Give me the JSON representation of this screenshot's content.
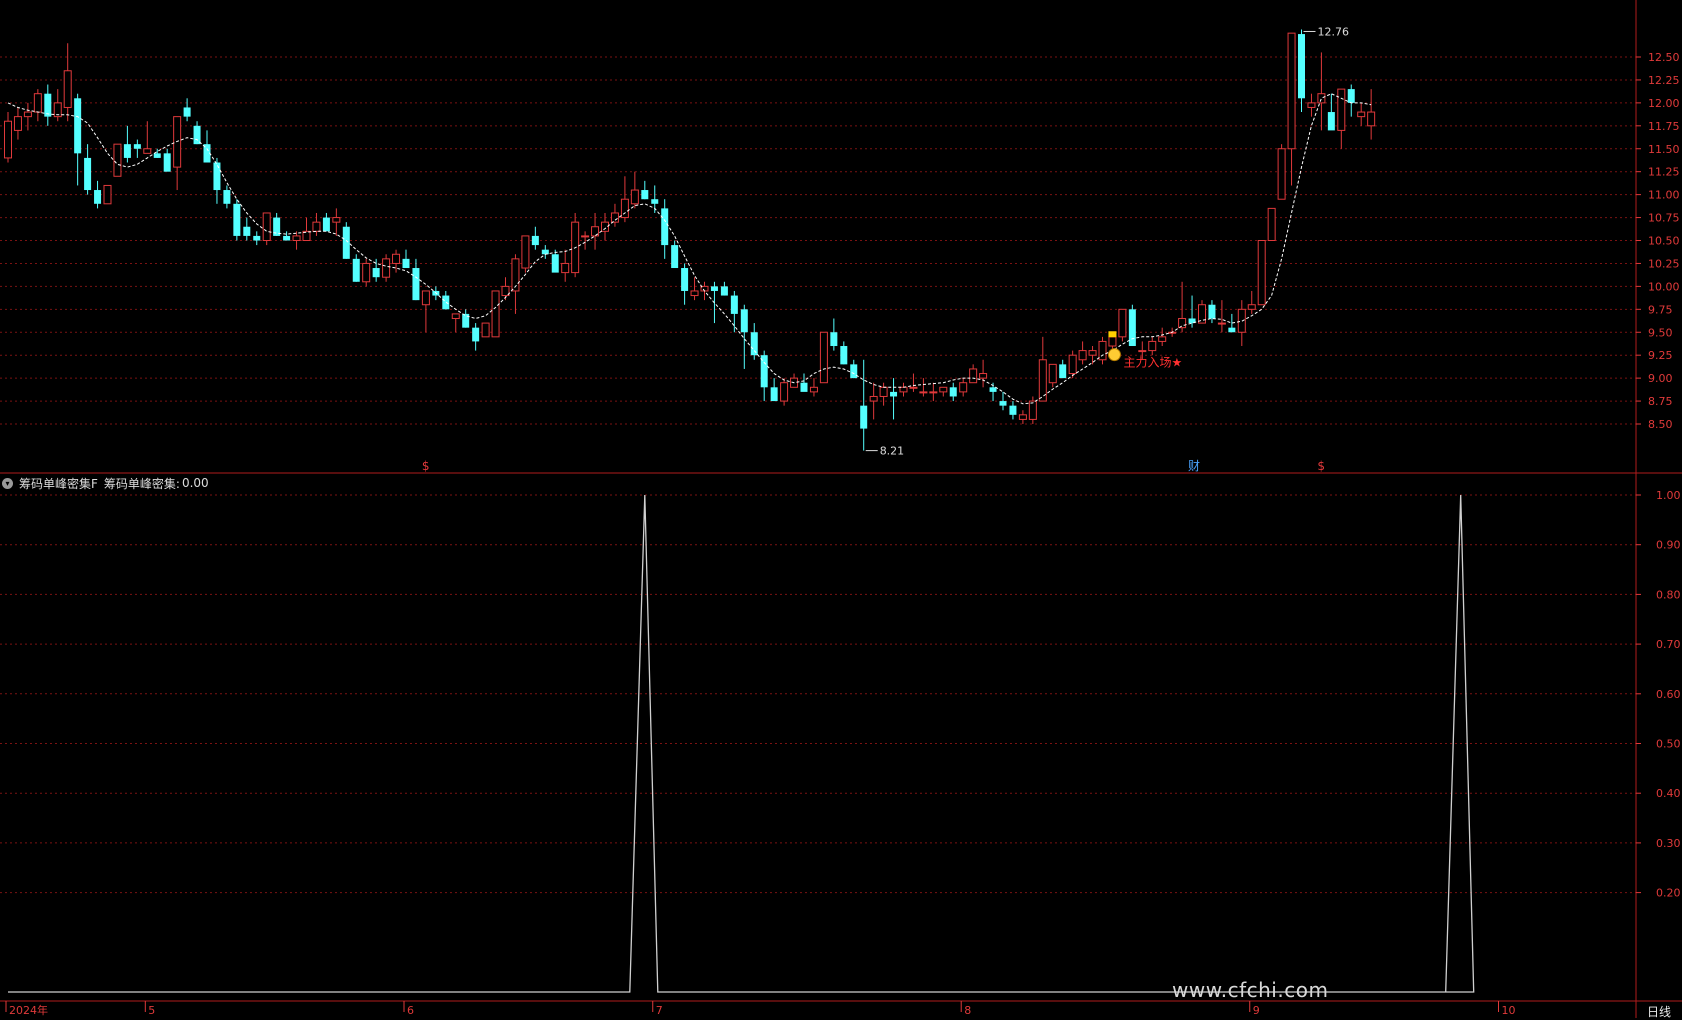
{
  "indicator": {
    "name": "筹码单峰密集F",
    "value_label": "筹码单峰密集:",
    "value": "0.00"
  },
  "watermark": "www.cfchi.com",
  "period_label": "日线",
  "colors": {
    "background": "#000000",
    "up": "#e0393b",
    "down": "#54ffff",
    "grid": "#7a1212",
    "axis_text": "#e03a3a",
    "ma": "#ffffff",
    "indicator_line": "#d0d0d0"
  },
  "chart_data": [
    {
      "type": "candlestick",
      "y_axis_ticks": [
        8.5,
        8.75,
        9.0,
        9.25,
        9.5,
        9.75,
        10.0,
        10.25,
        10.5,
        10.75,
        11.0,
        11.25,
        11.5,
        11.75,
        12.0,
        12.25,
        12.5
      ],
      "y_tick_labels": [
        "8.50",
        "8.75",
        "9.00",
        "9.25",
        "9.50",
        "9.75",
        "10.00",
        "10.25",
        "10.50",
        "10.75",
        "11.00",
        "11.25",
        "11.50",
        "11.75",
        "12.00",
        "12.25",
        "12.50"
      ],
      "ylim": [
        8.2,
        12.82
      ],
      "x_tick_labels": [
        "2024年",
        "5",
        "6",
        "7",
        "8",
        "9",
        "10"
      ],
      "x_tick_index": [
        0,
        14,
        40,
        65,
        96,
        125,
        150
      ],
      "max_annotation": "12.76",
      "min_annotation": "8.21",
      "signal_text": "主力入场★",
      "markers": [
        {
          "text": "$",
          "index": 42,
          "color": "#e0393b"
        },
        {
          "text": "财",
          "index": 119,
          "color": "#4aa3ff"
        },
        {
          "text": "$",
          "index": 132,
          "color": "#e0393b"
        }
      ],
      "ohlc": [
        [
          11.4,
          11.9,
          11.35,
          11.8
        ],
        [
          11.7,
          11.95,
          11.6,
          11.85
        ],
        [
          11.85,
          12.0,
          11.7,
          11.9
        ],
        [
          11.9,
          12.15,
          11.8,
          12.1
        ],
        [
          12.1,
          12.2,
          11.75,
          11.85
        ],
        [
          11.85,
          12.15,
          11.8,
          12.0
        ],
        [
          11.95,
          12.65,
          11.8,
          12.35
        ],
        [
          12.05,
          12.1,
          11.1,
          11.45
        ],
        [
          11.4,
          11.55,
          11.0,
          11.05
        ],
        [
          11.05,
          11.15,
          10.85,
          10.9
        ],
        [
          10.9,
          11.1,
          10.9,
          11.1
        ],
        [
          11.2,
          11.55,
          11.2,
          11.55
        ],
        [
          11.55,
          11.75,
          11.35,
          11.4
        ],
        [
          11.55,
          11.6,
          11.4,
          11.5
        ],
        [
          11.45,
          11.8,
          11.45,
          11.5
        ],
        [
          11.45,
          11.5,
          11.4,
          11.4
        ],
        [
          11.45,
          11.5,
          11.35,
          11.25
        ],
        [
          11.3,
          11.85,
          11.05,
          11.85
        ],
        [
          11.95,
          12.05,
          11.8,
          11.85
        ],
        [
          11.75,
          11.8,
          11.55,
          11.55
        ],
        [
          11.55,
          11.7,
          11.4,
          11.35
        ],
        [
          11.35,
          11.4,
          10.9,
          11.05
        ],
        [
          11.05,
          11.1,
          10.85,
          10.9
        ],
        [
          10.9,
          10.95,
          10.5,
          10.55
        ],
        [
          10.65,
          10.75,
          10.5,
          10.55
        ],
        [
          10.55,
          10.6,
          10.45,
          10.5
        ],
        [
          10.5,
          10.8,
          10.45,
          10.8
        ],
        [
          10.75,
          10.8,
          10.55,
          10.55
        ],
        [
          10.55,
          10.6,
          10.5,
          10.5
        ],
        [
          10.5,
          10.6,
          10.4,
          10.55
        ],
        [
          10.5,
          10.75,
          10.5,
          10.6
        ],
        [
          10.6,
          10.8,
          10.55,
          10.7
        ],
        [
          10.75,
          10.8,
          10.6,
          10.6
        ],
        [
          10.7,
          10.85,
          10.55,
          10.75
        ],
        [
          10.65,
          10.7,
          10.3,
          10.3
        ],
        [
          10.3,
          10.35,
          10.05,
          10.05
        ],
        [
          10.05,
          10.3,
          10.0,
          10.25
        ],
        [
          10.2,
          10.3,
          10.05,
          10.1
        ],
        [
          10.1,
          10.35,
          10.05,
          10.3
        ],
        [
          10.25,
          10.4,
          10.15,
          10.35
        ],
        [
          10.3,
          10.4,
          10.2,
          10.2
        ],
        [
          10.2,
          10.3,
          9.85,
          9.85
        ],
        [
          9.8,
          9.9,
          9.5,
          9.95
        ],
        [
          9.95,
          10.0,
          9.85,
          9.9
        ],
        [
          9.9,
          9.95,
          9.75,
          9.75
        ],
        [
          9.65,
          9.7,
          9.5,
          9.7
        ],
        [
          9.7,
          9.75,
          9.55,
          9.55
        ],
        [
          9.55,
          9.6,
          9.3,
          9.4
        ],
        [
          9.45,
          9.6,
          9.45,
          9.6
        ],
        [
          9.45,
          9.95,
          9.45,
          9.95
        ],
        [
          9.9,
          10.1,
          9.85,
          10.0
        ],
        [
          9.95,
          10.35,
          9.7,
          10.3
        ],
        [
          10.2,
          10.55,
          10.15,
          10.55
        ],
        [
          10.55,
          10.65,
          10.4,
          10.45
        ],
        [
          10.4,
          10.45,
          10.3,
          10.35
        ],
        [
          10.35,
          10.4,
          10.2,
          10.15
        ],
        [
          10.15,
          10.4,
          10.05,
          10.25
        ],
        [
          10.15,
          10.8,
          10.1,
          10.7
        ],
        [
          10.55,
          10.6,
          10.4,
          10.55
        ],
        [
          10.55,
          10.8,
          10.4,
          10.65
        ],
        [
          10.6,
          10.8,
          10.5,
          10.7
        ],
        [
          10.7,
          10.9,
          10.65,
          10.8
        ],
        [
          10.75,
          11.2,
          10.7,
          10.95
        ],
        [
          10.9,
          11.25,
          10.85,
          11.05
        ],
        [
          11.05,
          11.15,
          10.95,
          10.95
        ],
        [
          10.95,
          11.1,
          10.8,
          10.9
        ],
        [
          10.85,
          10.95,
          10.3,
          10.45
        ],
        [
          10.45,
          10.5,
          10.25,
          10.2
        ],
        [
          10.2,
          10.25,
          9.8,
          9.95
        ],
        [
          9.9,
          10.1,
          9.85,
          9.95
        ],
        [
          9.95,
          10.05,
          9.85,
          10.0
        ],
        [
          10.0,
          10.05,
          9.6,
          9.95
        ],
        [
          10.0,
          10.05,
          9.9,
          9.9
        ],
        [
          9.9,
          9.95,
          9.5,
          9.7
        ],
        [
          9.75,
          9.8,
          9.1,
          9.5
        ],
        [
          9.5,
          9.6,
          9.2,
          9.25
        ],
        [
          9.25,
          9.3,
          8.75,
          8.9
        ],
        [
          8.9,
          9.0,
          8.75,
          8.75
        ],
        [
          8.75,
          9.0,
          8.7,
          8.95
        ],
        [
          8.9,
          9.05,
          8.9,
          9.0
        ],
        [
          8.95,
          9.05,
          8.9,
          8.85
        ],
        [
          8.85,
          9.0,
          8.8,
          8.9
        ],
        [
          8.95,
          9.5,
          8.95,
          9.5
        ],
        [
          9.5,
          9.65,
          9.3,
          9.35
        ],
        [
          9.35,
          9.4,
          9.15,
          9.15
        ],
        [
          9.15,
          9.2,
          9.0,
          9.0
        ],
        [
          8.7,
          9.2,
          8.21,
          8.45
        ],
        [
          8.75,
          8.95,
          8.55,
          8.8
        ],
        [
          8.8,
          8.95,
          8.7,
          8.9
        ],
        [
          8.85,
          9.0,
          8.55,
          8.8
        ],
        [
          8.85,
          8.95,
          8.8,
          8.9
        ],
        [
          8.9,
          9.05,
          8.85,
          8.9
        ],
        [
          8.85,
          9.0,
          8.8,
          8.85
        ],
        [
          8.85,
          8.95,
          8.75,
          8.85
        ],
        [
          8.85,
          8.9,
          8.8,
          8.9
        ],
        [
          8.9,
          8.95,
          8.75,
          8.8
        ],
        [
          8.85,
          9.0,
          8.8,
          8.95
        ],
        [
          8.95,
          9.15,
          8.95,
          9.1
        ],
        [
          9.0,
          9.2,
          8.9,
          9.05
        ],
        [
          8.9,
          8.95,
          8.75,
          8.85
        ],
        [
          8.75,
          8.85,
          8.65,
          8.7
        ],
        [
          8.7,
          8.75,
          8.55,
          8.6
        ],
        [
          8.55,
          8.65,
          8.5,
          8.6
        ],
        [
          8.55,
          8.8,
          8.5,
          8.75
        ],
        [
          8.75,
          9.45,
          8.75,
          9.2
        ],
        [
          8.95,
          9.1,
          8.9,
          9.15
        ],
        [
          9.15,
          9.2,
          9.0,
          9.0
        ],
        [
          9.05,
          9.3,
          9.0,
          9.25
        ],
        [
          9.2,
          9.4,
          9.15,
          9.3
        ],
        [
          9.25,
          9.35,
          9.15,
          9.3
        ],
        [
          9.2,
          9.45,
          9.15,
          9.4
        ],
        [
          9.35,
          9.5,
          9.3,
          9.45
        ],
        [
          9.45,
          9.7,
          9.4,
          9.75
        ],
        [
          9.75,
          9.8,
          9.4,
          9.35
        ],
        [
          9.3,
          9.4,
          9.2,
          9.3
        ],
        [
          9.3,
          9.45,
          9.25,
          9.4
        ],
        [
          9.4,
          9.55,
          9.35,
          9.45
        ],
        [
          9.5,
          9.55,
          9.45,
          9.5
        ],
        [
          9.55,
          10.05,
          9.5,
          9.65
        ],
        [
          9.65,
          9.9,
          9.55,
          9.6
        ],
        [
          9.6,
          9.85,
          9.6,
          9.8
        ],
        [
          9.8,
          9.85,
          9.6,
          9.65
        ],
        [
          9.6,
          9.85,
          9.5,
          9.6
        ],
        [
          9.55,
          9.7,
          9.5,
          9.5
        ],
        [
          9.5,
          9.85,
          9.35,
          9.75
        ],
        [
          9.75,
          9.95,
          9.7,
          9.8
        ],
        [
          9.8,
          10.5,
          9.8,
          10.5
        ],
        [
          10.5,
          10.85,
          10.5,
          10.85
        ],
        [
          10.95,
          11.55,
          10.95,
          11.5
        ],
        [
          11.5,
          12.76,
          11.1,
          12.76
        ],
        [
          12.75,
          12.8,
          11.9,
          12.05
        ],
        [
          11.95,
          12.1,
          11.85,
          12.0
        ],
        [
          12.0,
          12.55,
          11.7,
          12.1
        ],
        [
          11.9,
          12.1,
          11.75,
          11.7
        ],
        [
          11.7,
          12.15,
          11.5,
          12.15
        ],
        [
          12.15,
          12.2,
          11.85,
          12.0
        ],
        [
          11.85,
          12.0,
          11.75,
          11.9
        ],
        [
          11.75,
          12.15,
          11.6,
          11.9
        ]
      ],
      "ma": [
        12.0,
        11.95,
        11.92,
        11.9,
        11.88,
        11.87,
        11.87,
        11.85,
        11.78,
        11.62,
        11.45,
        11.33,
        11.3,
        11.33,
        11.4,
        11.47,
        11.53,
        11.58,
        11.62,
        11.6,
        11.5,
        11.33,
        11.13,
        10.95,
        10.8,
        10.68,
        10.6,
        10.58,
        10.57,
        10.58,
        10.59,
        10.6,
        10.6,
        10.57,
        10.5,
        10.4,
        10.31,
        10.25,
        10.22,
        10.2,
        10.17,
        10.1,
        10.02,
        9.93,
        9.83,
        9.75,
        9.68,
        9.65,
        9.68,
        9.77,
        9.88,
        10.0,
        10.13,
        10.27,
        10.35,
        10.37,
        10.38,
        10.42,
        10.48,
        10.55,
        10.63,
        10.72,
        10.8,
        10.88,
        10.9,
        10.85,
        10.72,
        10.55,
        10.33,
        10.12,
        9.95,
        9.82,
        9.7,
        9.57,
        9.43,
        9.3,
        9.17,
        9.05,
        8.98,
        8.95,
        8.97,
        9.05,
        9.1,
        9.12,
        9.1,
        9.05,
        8.98,
        8.93,
        8.9,
        8.9,
        8.9,
        8.92,
        8.93,
        8.94,
        8.95,
        8.98,
        9.0,
        9.0,
        8.98,
        8.92,
        8.85,
        8.77,
        8.72,
        8.73,
        8.8,
        8.88,
        8.95,
        9.03,
        9.1,
        9.17,
        9.25,
        9.3,
        9.37,
        9.43,
        9.45,
        9.45,
        9.47,
        9.5,
        9.57,
        9.6,
        9.63,
        9.65,
        9.64,
        9.6,
        9.62,
        9.68,
        9.75,
        9.9,
        10.3,
        10.8,
        11.3,
        11.75,
        12.05,
        12.1,
        12.05,
        12.0,
        12.0,
        11.98
      ]
    },
    {
      "type": "line",
      "name": "筹码单峰密集",
      "ylim": [
        0.0,
        1.0
      ],
      "y_axis_ticks": [
        0.2,
        0.3,
        0.4,
        0.5,
        0.6,
        0.7,
        0.8,
        0.9,
        1.0
      ],
      "y_tick_labels": [
        "0.20",
        "0.30",
        "0.40",
        "0.50",
        "0.60",
        "0.70",
        "0.80",
        "0.90",
        "1.00"
      ],
      "baseline": 0,
      "spike_indices": [
        64,
        146
      ],
      "value_at_spike": 1.0
    }
  ]
}
